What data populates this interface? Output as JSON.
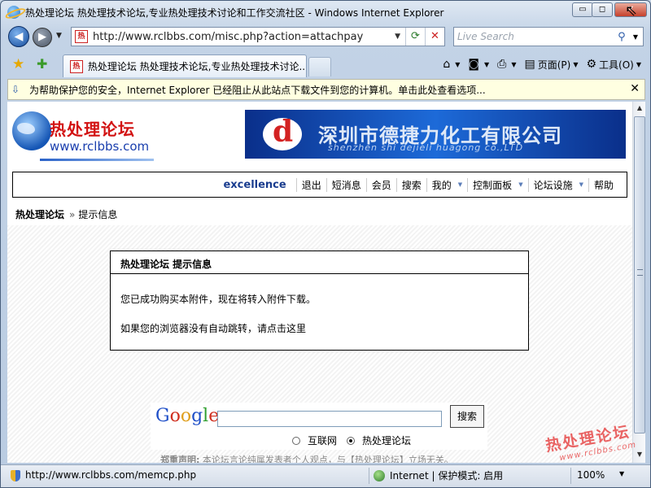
{
  "window": {
    "title": "热处理论坛 热处理技术论坛,专业热处理技术讨论和工作交流社区 - Windows Internet Explorer",
    "min_label": "▭",
    "max_label": "◻",
    "close_label": "✕"
  },
  "address": {
    "url": "http://www.rclbbs.com/misc.php?action=attachpay",
    "refresh_icon": "refresh-icon",
    "stop_icon": "stop-icon"
  },
  "search": {
    "placeholder": "Live Search"
  },
  "tab": {
    "title": "热处理论坛 热处理技术论坛,专业热处理技术讨论..."
  },
  "commands": {
    "page_label": "页面(P)",
    "tools_label": "工具(O)"
  },
  "infobar": {
    "text": "为帮助保护您的安全，Internet Explorer 已经阻止从此站点下载文件到您的计算机。单击此处查看选项..."
  },
  "site": {
    "logo_title": "热处理论坛",
    "logo_url": "www.rclbbs.com",
    "banner_title": "深圳市德捷力化工有限公司",
    "banner_sub": "shenzhen shi dejieli huagong co.,LTD"
  },
  "menu": {
    "user": "excellence",
    "items": [
      {
        "label": "退出"
      },
      {
        "label": "短消息"
      },
      {
        "label": "会员"
      },
      {
        "label": "搜索"
      },
      {
        "label": "我的"
      },
      {
        "label": "控制面板"
      },
      {
        "label": "论坛设施"
      },
      {
        "label": "帮助"
      }
    ]
  },
  "breadcrumb": {
    "home": "热处理论坛",
    "sep": "»",
    "current": "提示信息"
  },
  "message": {
    "title": "热处理论坛  提示信息",
    "line1": "您已成功购买本附件，现在将转入附件下载。",
    "line2": "如果您的浏览器没有自动跳转，请点击这里"
  },
  "google": {
    "button": "搜索",
    "option_web": "互联网",
    "option_site": "热处理论坛",
    "selected": "热处理论坛"
  },
  "footer": {
    "note_bold": "郑重声明:",
    "note_text": " 本论坛言论纯属发表者个人观点，与【热处理论坛】立场无关。"
  },
  "watermark": {
    "title": "热处理论坛",
    "url": "www.rclbbs.com"
  },
  "status": {
    "url": "http://www.rclbbs.com/memcp.php",
    "zone": "Internet | 保护模式: 启用",
    "zoom": "100%"
  }
}
